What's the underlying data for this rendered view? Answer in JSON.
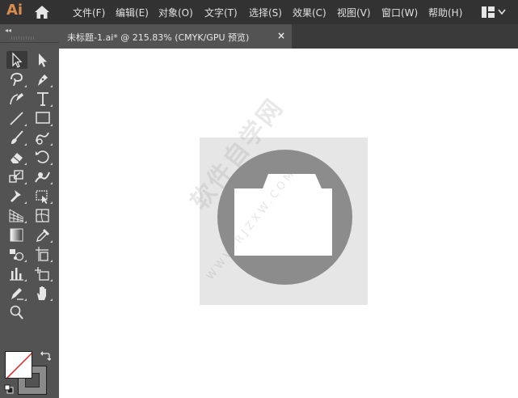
{
  "app": {
    "logo_text": "Ai",
    "brand_color": "#d98c4f",
    "home_icon": "home-icon",
    "workspace_icon": "workspace-switcher-icon"
  },
  "menu": [
    {
      "label": "文件(F)"
    },
    {
      "label": "编辑(E)"
    },
    {
      "label": "对象(O)"
    },
    {
      "label": "文字(T)"
    },
    {
      "label": "选择(S)"
    },
    {
      "label": "效果(C)"
    },
    {
      "label": "视图(V)"
    },
    {
      "label": "窗口(W)"
    },
    {
      "label": "帮助(H)"
    }
  ],
  "toolbar": {
    "collapse_glyph": "◂◂",
    "tools": [
      {
        "name": "selection-tool-icon"
      },
      {
        "name": "direct-selection-tool-icon"
      },
      {
        "name": "magic-wand-tool-icon"
      },
      {
        "name": "pen-tool-icon"
      },
      {
        "name": "curvature-tool-icon"
      },
      {
        "name": "type-tool-icon"
      },
      {
        "name": "line-segment-tool-icon"
      },
      {
        "name": "rectangle-tool-icon"
      },
      {
        "name": "paintbrush-tool-icon"
      },
      {
        "name": "shaper-tool-icon"
      },
      {
        "name": "eraser-tool-icon"
      },
      {
        "name": "rotate-tool-icon"
      },
      {
        "name": "scale-tool-icon"
      },
      {
        "name": "warp-tool-icon"
      },
      {
        "name": "puppet-warp-tool-icon"
      },
      {
        "name": "free-transform-tool-icon"
      },
      {
        "name": "perspective-grid-tool-icon"
      },
      {
        "name": "mesh-tool-icon"
      },
      {
        "name": "gradient-tool-icon"
      },
      {
        "name": "eyedropper-tool-icon"
      },
      {
        "name": "symbol-sprayer-tool-icon"
      },
      {
        "name": "artboard-tool-icon"
      },
      {
        "name": "column-graph-tool-icon"
      },
      {
        "name": "slice-tool-icon"
      },
      {
        "name": "brush-edit-tool-icon"
      },
      {
        "name": "hand-tool-icon"
      },
      {
        "name": "zoom-tool-icon"
      }
    ],
    "fill_color": "#ffffff",
    "stroke_color": "none",
    "swap_icon": "swap-fill-stroke-icon",
    "default_icon": "default-fill-stroke-icon",
    "modes": [
      "color-mode-icon",
      "gradient-mode-icon",
      "none-mode-icon"
    ]
  },
  "document": {
    "tab_title": "未标题-1.ai* @ 215.83% (CMYK/GPU 预览)",
    "close_glyph": "×"
  },
  "canvas": {
    "artwork_bg_color": "#e6e6e6",
    "circle_color": "#8c8c8c",
    "folder_color": "#ffffff",
    "watermark_text": "软件自学网",
    "watermark_url": "WWW.RJZXW.COM"
  }
}
